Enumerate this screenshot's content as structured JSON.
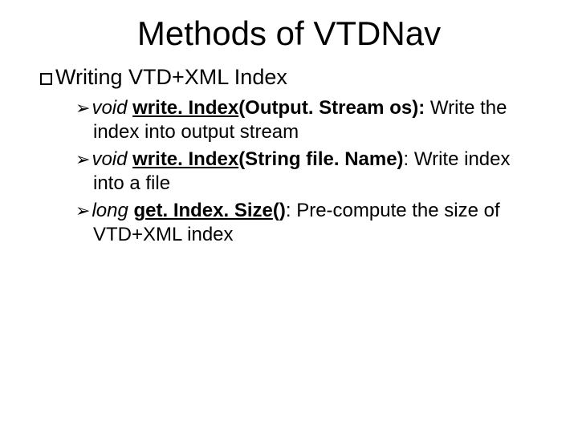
{
  "title": "Methods of VTDNav",
  "section": {
    "heading": "Writing VTD+XML Index",
    "items": [
      {
        "ret": "void",
        "method": "write. Index",
        "sig": "(Output. Stream os):",
        "desc_lead": " Write",
        "desc_rest": "the index into output stream"
      },
      {
        "ret": "void",
        "method": "write. Index",
        "sig": "(String file. Name)",
        "desc_lead": ": Write",
        "desc_rest": "index into a file"
      },
      {
        "ret": "long",
        "method": "get. Index. Size",
        "sig": "()",
        "desc_lead": ": Pre-compute the size",
        "desc_rest": "of VTD+XML index"
      }
    ]
  }
}
